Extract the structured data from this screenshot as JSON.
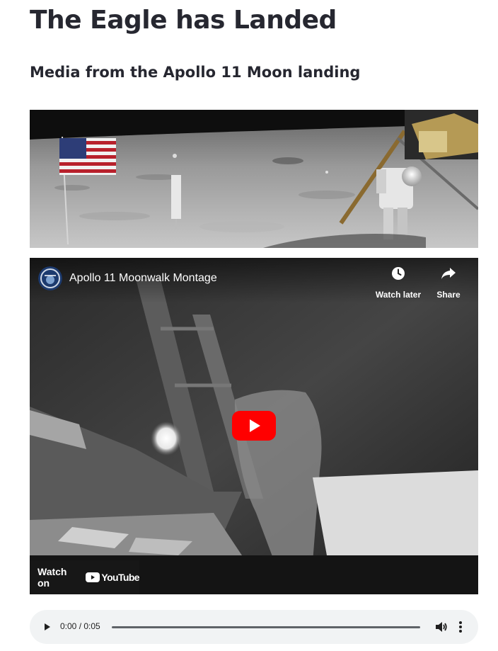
{
  "page": {
    "title": "The Eagle has Landed",
    "subtitle": "Media from the Apollo 11 Moon landing"
  },
  "image": {
    "icon": "moon-landing-photo"
  },
  "video": {
    "title": "Apollo 11 Moonwalk Montage",
    "watch_later_label": "Watch later",
    "share_label": "Share",
    "watch_on_label": "Watch on",
    "youtube_label": "YouTube",
    "play_icon": "play-icon",
    "brand_color": "#ff0000"
  },
  "audio": {
    "time": "0:00 / 0:05",
    "progress": 0
  }
}
